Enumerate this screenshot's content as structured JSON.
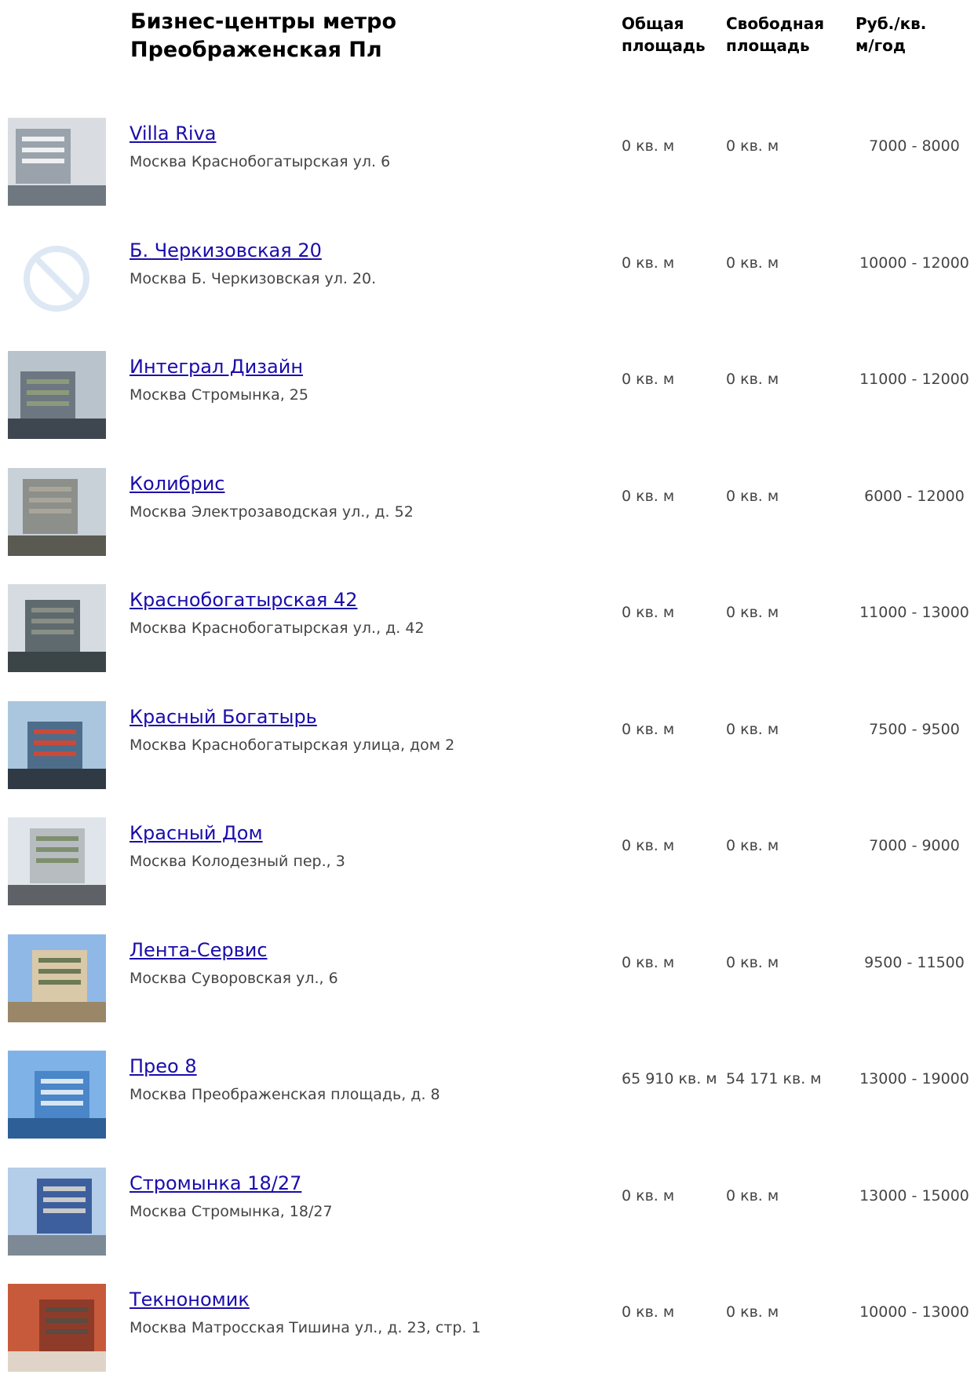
{
  "title": "Бизнес-центры метро Преображенская Пл",
  "columns": {
    "total": [
      "Общая",
      "площадь"
    ],
    "free": [
      "Свободная",
      "площадь"
    ],
    "price": [
      "Руб./кв.",
      "м/год"
    ]
  },
  "rows": [
    {
      "name": "Villa Riva",
      "address": "Москва Краснобогатырская ул. 6",
      "total": "0 кв. м",
      "free": "0 кв. м",
      "price": "7000 - 8000",
      "photo": "building-photo"
    },
    {
      "name": "Б. Черкизовская 20",
      "address": "Москва Б. Черкизовская ул. 20.",
      "total": "0 кв. м",
      "free": "0 кв. м",
      "price": "10000 - 12000",
      "photo": "no-photo-icon"
    },
    {
      "name": "Интеграл Дизайн",
      "address": "Москва Стромынка, 25",
      "total": "0 кв. м",
      "free": "0 кв. м",
      "price": "11000 - 12000",
      "photo": "building-photo"
    },
    {
      "name": "Колибрис",
      "address": "Москва Электрозаводская ул., д. 52",
      "total": "0 кв. м",
      "free": "0 кв. м",
      "price": "6000 - 12000",
      "photo": "building-photo"
    },
    {
      "name": "Краснобогатырская 42",
      "address": "Москва Краснобогатырская ул., д. 42",
      "total": "0 кв. м",
      "free": "0 кв. м",
      "price": "11000 - 13000",
      "photo": "building-photo"
    },
    {
      "name": "Красный Богатырь",
      "address": "Москва Краснобогатырская улица, дом 2",
      "total": "0 кв. м",
      "free": "0 кв. м",
      "price": "7500 - 9500",
      "photo": "building-photo"
    },
    {
      "name": "Красный Дом",
      "address": "Москва Колодезный пер., 3",
      "total": "0 кв. м",
      "free": "0 кв. м",
      "price": "7000 - 9000",
      "photo": "building-photo"
    },
    {
      "name": "Лента-Сервис",
      "address": "Москва Суворовская ул., 6",
      "total": "0 кв. м",
      "free": "0 кв. м",
      "price": "9500 - 11500",
      "photo": "building-photo"
    },
    {
      "name": "Прео 8",
      "address": "Москва Преображенская площадь, д. 8",
      "total": "65 910 кв. м",
      "free": "54 171 кв. м",
      "price": "13000 - 19000",
      "photo": "building-photo"
    },
    {
      "name": "Стромынка 18/27",
      "address": "Москва Стромынка, 18/27",
      "total": "0 кв. м",
      "free": "0 кв. м",
      "price": "13000 - 15000",
      "photo": "building-photo"
    },
    {
      "name": "Текнономик",
      "address": "Москва Матросская Тишина ул., д. 23, стр. 1",
      "total": "0 кв. м",
      "free": "0 кв. м",
      "price": "10000 - 13000",
      "photo": "building-photo"
    }
  ],
  "colors": {
    "link": "#1a0dab",
    "text": "#444444",
    "heading": "#000000"
  }
}
